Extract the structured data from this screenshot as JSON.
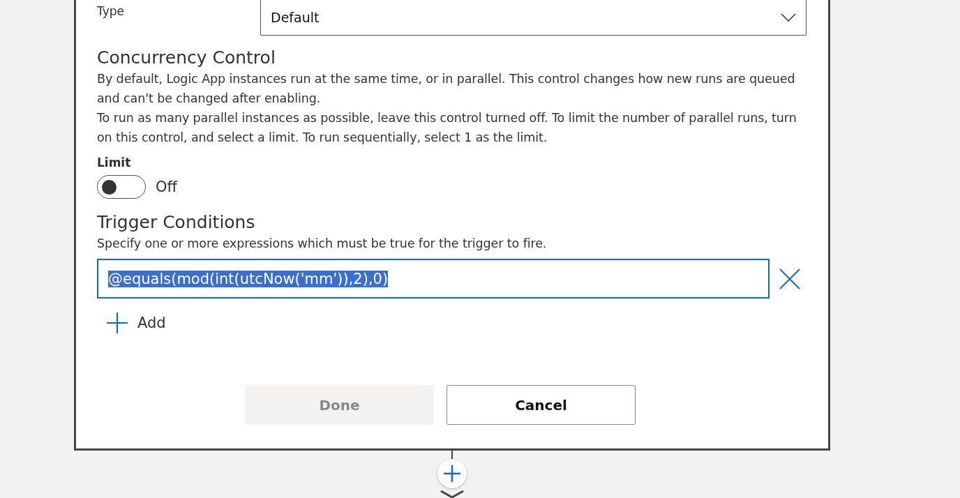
{
  "type_field": {
    "label": "Type",
    "value": "Default"
  },
  "concurrency": {
    "heading": "Concurrency Control",
    "paragraphs": [
      "By default, Logic App instances run at the same time, or in parallel. This control changes how new runs are queued and can't be changed after enabling.",
      "To run as many parallel instances as possible, leave this control turned off. To limit the number of parallel runs, turn on this control, and select a limit. To run sequentially, select 1 as the limit."
    ],
    "limit_label": "Limit",
    "limit": {
      "on": false,
      "state_label": "Off"
    }
  },
  "trigger_conditions": {
    "heading": "Trigger Conditions",
    "description": "Specify one or more expressions which must be true for the trigger to fire.",
    "conditions": [
      {
        "value": "@equals(mod(int(utcNow('mm')),2),0)",
        "text_selected": true
      }
    ],
    "add_label": "Add"
  },
  "buttons": [
    {
      "label": "Done",
      "disabled": true
    },
    {
      "label": "Cancel",
      "disabled": false
    }
  ]
}
